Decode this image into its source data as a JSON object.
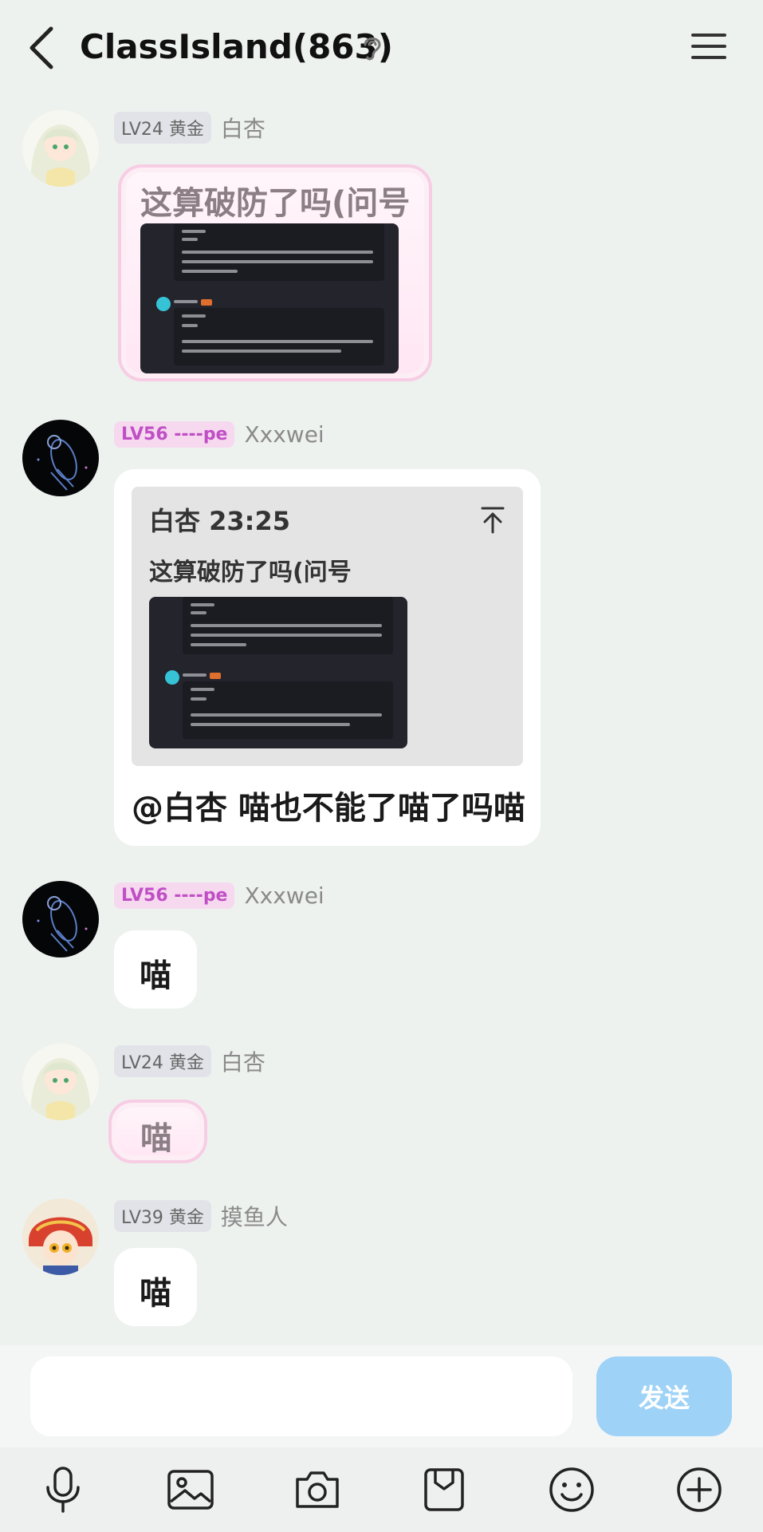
{
  "header": {
    "title": "ClassIsland(863)"
  },
  "messages": [
    {
      "level": "LV24 黄金",
      "nick": "白杏",
      "text": "这算破防了吗(问号"
    },
    {
      "level": "LV56 ----pe",
      "nick": "Xxxwei",
      "quote_head": "白杏 23:25",
      "quote_text": "这算破防了吗(问号",
      "text": "@白杏 喵也不能了喵了吗喵"
    },
    {
      "level": "LV56 ----pe",
      "nick": "Xxxwei",
      "text": "喵"
    },
    {
      "level": "LV24 黄金",
      "nick": "白杏",
      "text": "喵"
    },
    {
      "level": "LV39 黄金",
      "nick": "摸鱼人",
      "text": "喵"
    }
  ],
  "input": {
    "placeholder": "",
    "send_label": "发送"
  },
  "toolbar": [
    "microphone-icon",
    "image-icon",
    "camera-icon",
    "sticker-icon",
    "emoji-icon",
    "plus-icon"
  ],
  "colors": {
    "send_button": "#9ed2f7",
    "background": "#eef2ef",
    "badge_pink": "#c04fc6"
  }
}
